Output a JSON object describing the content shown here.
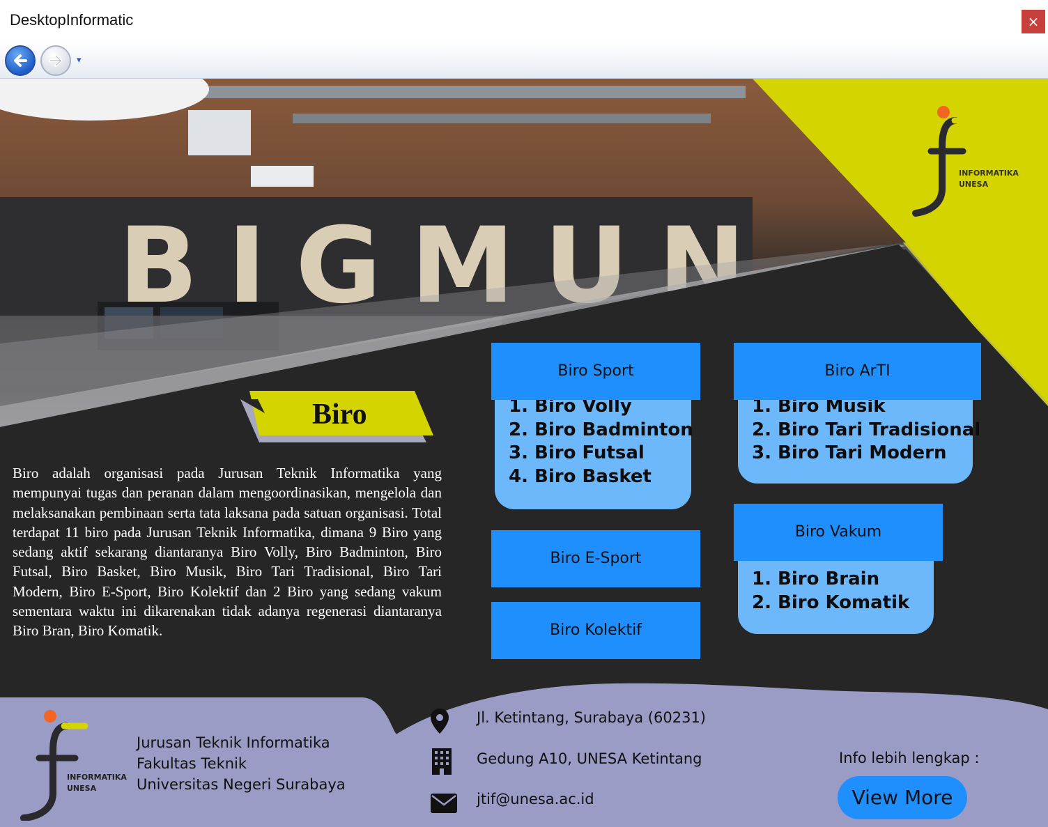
{
  "window": {
    "title": "DesktopInformatic",
    "close_glyph": "×"
  },
  "nav": {
    "back_icon": "back-arrow-icon",
    "forward_icon": "forward-arrow-icon",
    "dropdown_glyph": "▾"
  },
  "logo": {
    "line1": "INFORMATIKA",
    "line2": "UNESA"
  },
  "section": {
    "title": "Biro",
    "description": "Biro adalah organisasi pada Jurusan Teknik Informatika yang mempunyai tugas dan peranan dalam mengoordinasikan, mengelola dan melaksanakan pembinaan serta tata laksana pada satuan organisasi. Total terdapat 11 biro pada Jurusan Teknik Informatika, dimana 9 Biro yang sedang aktif sekarang diantaranya Biro Volly, Biro Badminton, Biro Futsal, Biro Basket, Biro Musik, Biro Tari Tradisional, Biro Tari Modern, Biro E-Sport, Biro Kolektif dan 2 Biro yang sedang vakum sementara waktu ini dikarenakan tidak adanya regenerasi diantaranya Biro Bran, Biro Komatik."
  },
  "cards": {
    "sport": {
      "title": "Biro Sport",
      "items": [
        "1. Biro Volly",
        "2. Biro Badminton",
        "3. Biro Futsal",
        "4. Biro Basket"
      ]
    },
    "arti": {
      "title": "Biro ArTI",
      "items": [
        "1. Biro Musik",
        "2. Biro Tari Tradisional",
        "3. Biro Tari Modern"
      ]
    },
    "esport": {
      "title": "Biro E-Sport"
    },
    "kolektif": {
      "title": "Biro Kolektif"
    },
    "vakum": {
      "title": "Biro Vakum",
      "items": [
        "1. Biro Brain",
        "2. Biro Komatik"
      ]
    }
  },
  "footer": {
    "org": [
      "Jurusan Teknik Informatika",
      "Fakultas Teknik",
      "Universitas Negeri Surabaya"
    ],
    "address": "Jl. Ketintang, Surabaya (60231)",
    "building": "Gedung A10, UNESA Ketintang",
    "email": "jtif@unesa.ac.id",
    "info_label": "Info lebih lengkap :",
    "view_more": "View More"
  },
  "colors": {
    "accent_blue": "#1e8ffd",
    "light_blue": "#6db8fb",
    "yellow": "#d4d400",
    "dark": "#262626",
    "footer_purple": "#9a9cc6"
  }
}
